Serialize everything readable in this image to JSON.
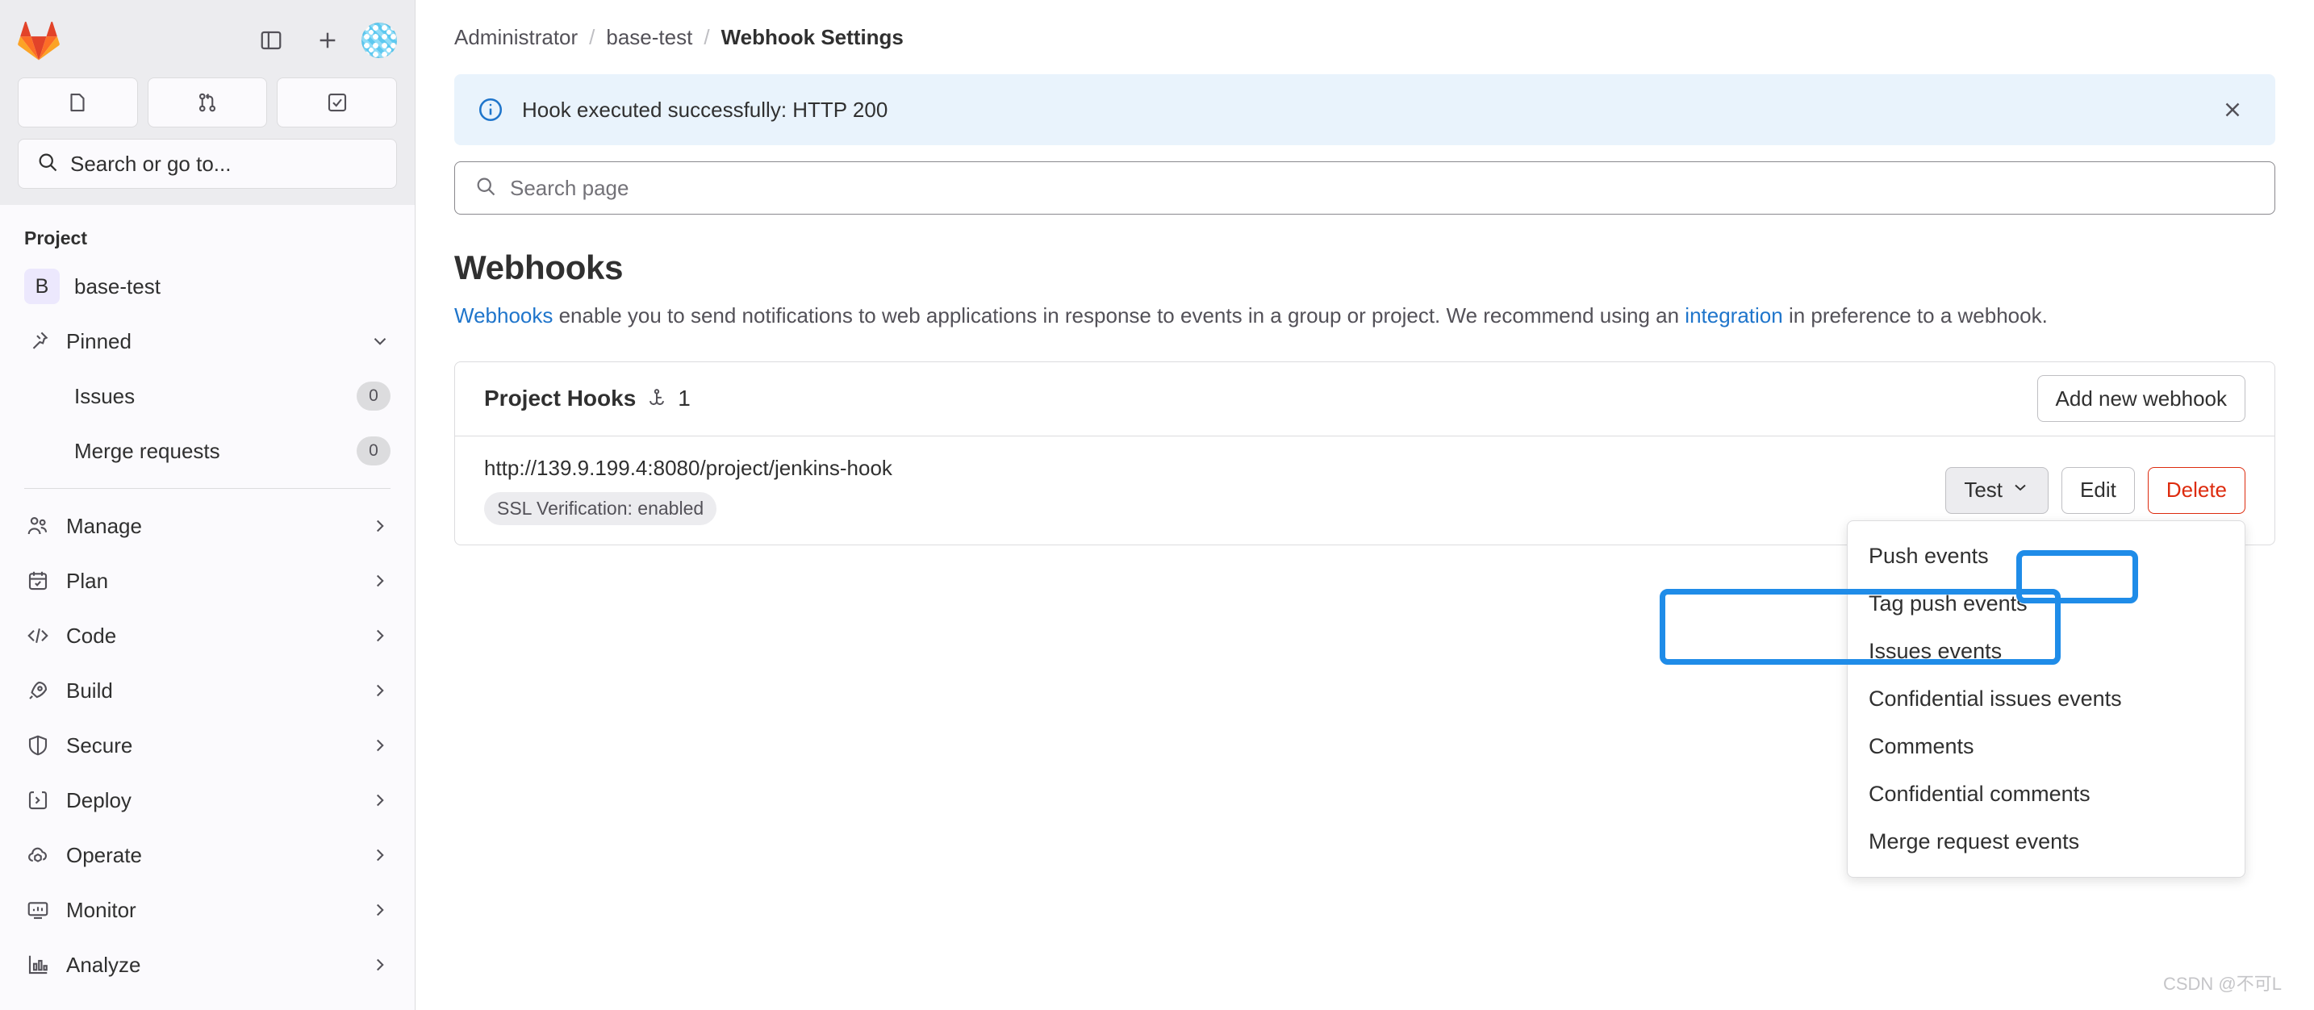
{
  "colors": {
    "accent_blue": "#1f75cb",
    "annotation_blue": "#1f8ce8",
    "danger_red": "#dd2b0e",
    "alert_bg": "#e9f3fc",
    "sidebar_bg": "#fbfafd",
    "sidebar_top_bg": "#ececef"
  },
  "sidebar": {
    "logo_icon": "gitlab-logo-icon",
    "toggle_icon": "sidebar-toggle-icon",
    "new_icon": "plus-icon",
    "avatar_icon": "user-avatar",
    "quick_actions": [
      {
        "name": "issues-quick-action",
        "icon": "issue-icon"
      },
      {
        "name": "merge-requests-quick-action",
        "icon": "merge-request-icon"
      },
      {
        "name": "todos-quick-action",
        "icon": "todo-checkbox-icon"
      }
    ],
    "search": {
      "icon": "search-icon",
      "label": "Search or go to..."
    },
    "section_title": "Project",
    "project": {
      "initial": "B",
      "name": "base-test"
    },
    "pinned": {
      "label": "Pinned",
      "icon": "pin-icon",
      "chevron": "chevron-down-icon",
      "children": [
        {
          "label": "Issues",
          "count": "0"
        },
        {
          "label": "Merge requests",
          "count": "0"
        }
      ]
    },
    "items": [
      {
        "label": "Manage",
        "icon": "users-icon",
        "chevron": "chevron-right-icon"
      },
      {
        "label": "Plan",
        "icon": "calendar-icon",
        "chevron": "chevron-right-icon"
      },
      {
        "label": "Code",
        "icon": "code-icon",
        "chevron": "chevron-right-icon"
      },
      {
        "label": "Build",
        "icon": "rocket-icon",
        "chevron": "chevron-right-icon"
      },
      {
        "label": "Secure",
        "icon": "shield-icon",
        "chevron": "chevron-right-icon"
      },
      {
        "label": "Deploy",
        "icon": "deploy-icon",
        "chevron": "chevron-right-icon"
      },
      {
        "label": "Operate",
        "icon": "cloud-pod-icon",
        "chevron": "chevron-right-icon"
      },
      {
        "label": "Monitor",
        "icon": "monitor-icon",
        "chevron": "chevron-right-icon"
      },
      {
        "label": "Analyze",
        "icon": "chart-icon",
        "chevron": "chevron-right-icon"
      }
    ]
  },
  "breadcrumb": {
    "items": [
      "Administrator",
      "base-test"
    ],
    "separator": "/",
    "current": "Webhook Settings"
  },
  "alert": {
    "icon": "information-circle-icon",
    "message": "Hook executed successfully: HTTP 200",
    "close_icon": "close-icon"
  },
  "page_search": {
    "icon": "search-icon",
    "placeholder": "Search page",
    "value": ""
  },
  "page": {
    "title": "Webhooks",
    "desc_link_1": "Webhooks",
    "desc_part_1": " enable you to send notifications to web applications in response to events in a group or project. We recommend using an ",
    "desc_link_2": "integration",
    "desc_part_2": " in preference to a webhook."
  },
  "hooks_card": {
    "title": "Project Hooks",
    "hook_icon": "hook-icon",
    "count": "1",
    "add_button": "Add new webhook",
    "rows": [
      {
        "url": "http://139.9.199.4:8080/project/jenkins-hook",
        "ssl_badge": "SSL Verification: enabled",
        "test_button": "Test",
        "test_chevron": "chevron-down-icon",
        "edit_button": "Edit",
        "delete_button": "Delete"
      }
    ]
  },
  "test_dropdown": {
    "open": true,
    "items": [
      "Push events",
      "Tag push events",
      "Issues events",
      "Confidential issues events",
      "Comments",
      "Confidential comments",
      "Merge request events"
    ]
  },
  "watermark": "CSDN @不可L"
}
